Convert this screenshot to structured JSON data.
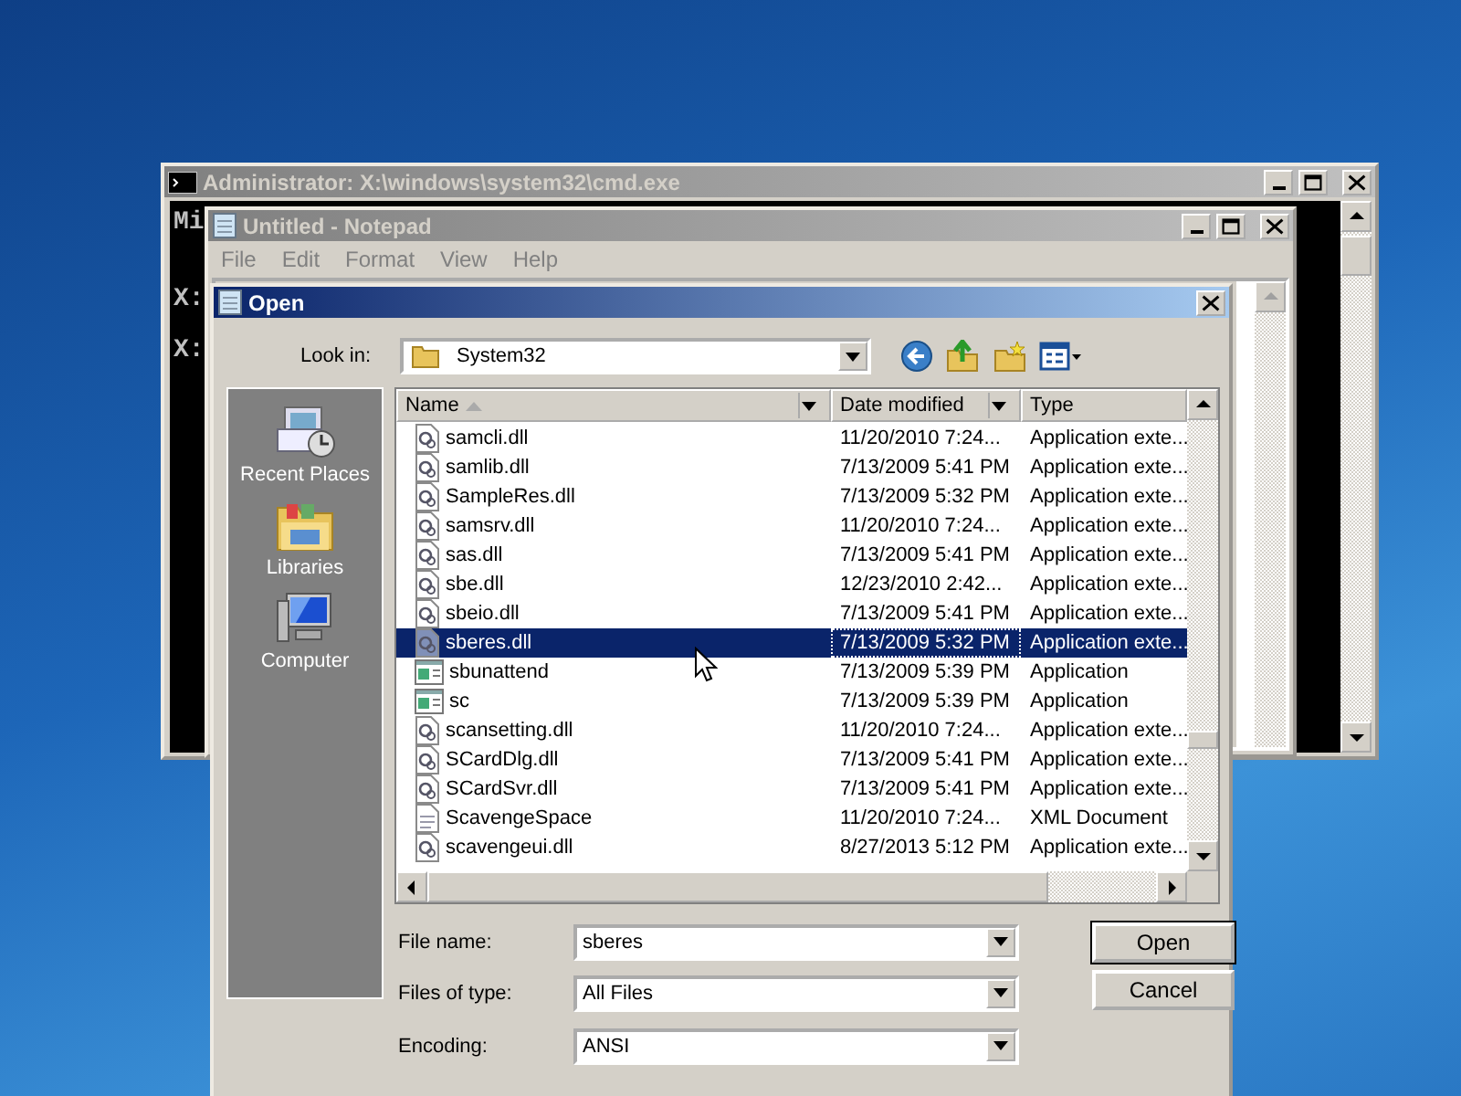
{
  "console_window": {
    "title": "Administrator: X:\\windows\\system32\\cmd.exe",
    "lines": [
      "Mi",
      "X:",
      "X:"
    ]
  },
  "notepad_window": {
    "title": "Untitled - Notepad",
    "menu": [
      "File",
      "Edit",
      "Format",
      "View",
      "Help"
    ]
  },
  "open_dialog": {
    "title": "Open",
    "look_in_label": "Look in:",
    "look_in_value": "System32",
    "places": [
      {
        "label": "Recent Places",
        "kind": "recent"
      },
      {
        "label": "Libraries",
        "kind": "libraries"
      },
      {
        "label": "Computer",
        "kind": "computer"
      }
    ],
    "columns": [
      "Name",
      "Date modified",
      "Type"
    ],
    "files": [
      {
        "name": "samcli.dll",
        "date": "11/20/2010 7:24...",
        "type": "Application exte...",
        "kind": "dll",
        "selected": false
      },
      {
        "name": "samlib.dll",
        "date": "7/13/2009 5:41 PM",
        "type": "Application exte...",
        "kind": "dll",
        "selected": false
      },
      {
        "name": "SampleRes.dll",
        "date": "7/13/2009 5:32 PM",
        "type": "Application exte...",
        "kind": "dll",
        "selected": false
      },
      {
        "name": "samsrv.dll",
        "date": "11/20/2010 7:24...",
        "type": "Application exte...",
        "kind": "dll",
        "selected": false
      },
      {
        "name": "sas.dll",
        "date": "7/13/2009 5:41 PM",
        "type": "Application exte...",
        "kind": "dll",
        "selected": false
      },
      {
        "name": "sbe.dll",
        "date": "12/23/2010 2:42...",
        "type": "Application exte...",
        "kind": "dll",
        "selected": false
      },
      {
        "name": "sbeio.dll",
        "date": "7/13/2009 5:41 PM",
        "type": "Application exte...",
        "kind": "dll",
        "selected": false
      },
      {
        "name": "sberes.dll",
        "date": "7/13/2009 5:32 PM",
        "type": "Application exte...",
        "kind": "dll",
        "selected": true
      },
      {
        "name": "sbunattend",
        "date": "7/13/2009 5:39 PM",
        "type": "Application",
        "kind": "app",
        "selected": false
      },
      {
        "name": "sc",
        "date": "7/13/2009 5:39 PM",
        "type": "Application",
        "kind": "app",
        "selected": false
      },
      {
        "name": "scansetting.dll",
        "date": "11/20/2010 7:24...",
        "type": "Application exte...",
        "kind": "dll",
        "selected": false
      },
      {
        "name": "SCardDlg.dll",
        "date": "7/13/2009 5:41 PM",
        "type": "Application exte...",
        "kind": "dll",
        "selected": false
      },
      {
        "name": "SCardSvr.dll",
        "date": "7/13/2009 5:41 PM",
        "type": "Application exte...",
        "kind": "dll",
        "selected": false
      },
      {
        "name": "ScavengeSpace",
        "date": "11/20/2010 7:24...",
        "type": "XML Document",
        "kind": "xml",
        "selected": false
      },
      {
        "name": "scavengeui.dll",
        "date": "8/27/2013 5:12 PM",
        "type": "Application exte...",
        "kind": "dll",
        "selected": false
      }
    ],
    "fields": [
      {
        "label": "File name:",
        "value": "sberes"
      },
      {
        "label": "Files of type:",
        "value": "All Files"
      },
      {
        "label": "Encoding:",
        "value": "ANSI"
      }
    ],
    "buttons": [
      "Open",
      "Cancel"
    ]
  }
}
